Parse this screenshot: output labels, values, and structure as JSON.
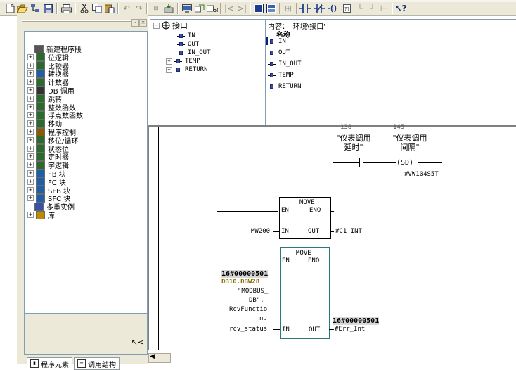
{
  "toolbar": {
    "icons": [
      "new-icon",
      "open-icon",
      "network-icon",
      "save-icon",
      "print-icon",
      "cut-icon",
      "copy-icon",
      "paste-icon",
      "undo-icon",
      "redo-icon",
      "compare-icon",
      "download-icon",
      "monitor-icon",
      "move-icon",
      "online-icon",
      "first-icon",
      "last-icon",
      "box-icon",
      "overview-icon",
      "grid-icon",
      "contact-no-icon",
      "contact-nc-icon",
      "coil-icon",
      "box2-icon",
      "branch-open-icon",
      "branch-close-icon",
      "help-icon"
    ]
  },
  "left_panel": {
    "tree": [
      {
        "label": "新建程序段",
        "expander": ""
      },
      {
        "label": "位逻辑",
        "expander": "+"
      },
      {
        "label": "比较器",
        "expander": "+"
      },
      {
        "label": "转换器",
        "expander": "+"
      },
      {
        "label": "计数器",
        "expander": "+"
      },
      {
        "label": "DB 调用",
        "expander": "+"
      },
      {
        "label": "跳转",
        "expander": "+"
      },
      {
        "label": "整数函数",
        "expander": "+"
      },
      {
        "label": "浮点数函数",
        "expander": "+"
      },
      {
        "label": "移动",
        "expander": "+"
      },
      {
        "label": "程序控制",
        "expander": "+"
      },
      {
        "label": "移位/循环",
        "expander": "+"
      },
      {
        "label": "状态位",
        "expander": "+"
      },
      {
        "label": "定时器",
        "expander": "+"
      },
      {
        "label": "字逻辑",
        "expander": "+"
      },
      {
        "label": "FB 块",
        "expander": "+"
      },
      {
        "label": "FC 块",
        "expander": "+"
      },
      {
        "label": "SFB 块",
        "expander": "+"
      },
      {
        "label": "SFC 块",
        "expander": "+"
      },
      {
        "label": "多重实例",
        "expander": ""
      },
      {
        "label": "库",
        "expander": "+"
      }
    ],
    "tabs": [
      "程序元素",
      "调用结构"
    ]
  },
  "interface": {
    "root": "接口",
    "children": [
      "IN",
      "OUT",
      "IN_OUT",
      "TEMP",
      "RETURN"
    ],
    "contents_label": "内容：  '环境\\接口'",
    "column_header": "名称",
    "rows": [
      "IN",
      "OUT",
      "IN_OUT",
      "TEMP",
      "RETURN"
    ]
  },
  "ladder": {
    "top_numbers": [
      "138",
      "145"
    ],
    "contact_comment_1": "\"仪表调用\n延时\"",
    "contact_comment_2": "\"仪表调用\n间隔\"",
    "coil_label": "(SD)",
    "timer_address": "#VW104S5T",
    "move1": {
      "title": "MOVE",
      "en": "EN",
      "eno": "ENO",
      "in_label": "IN",
      "out_label": "OUT",
      "in_value": "MW200",
      "out_value": "#C1_INT"
    },
    "move2": {
      "title": "MOVE",
      "en": "EN",
      "eno": "ENO",
      "in_label": "IN",
      "out_label": "OUT",
      "in_status": "16#00000501",
      "in_addr": "DB10.DBW28",
      "in_symbol_lines": [
        "\"MODBUS_",
        "DB\".",
        "RcvFunctio",
        "n."
      ],
      "in_value": "rcv_status",
      "out_status": "16#00000501",
      "out_value": "#Err_Int"
    }
  }
}
